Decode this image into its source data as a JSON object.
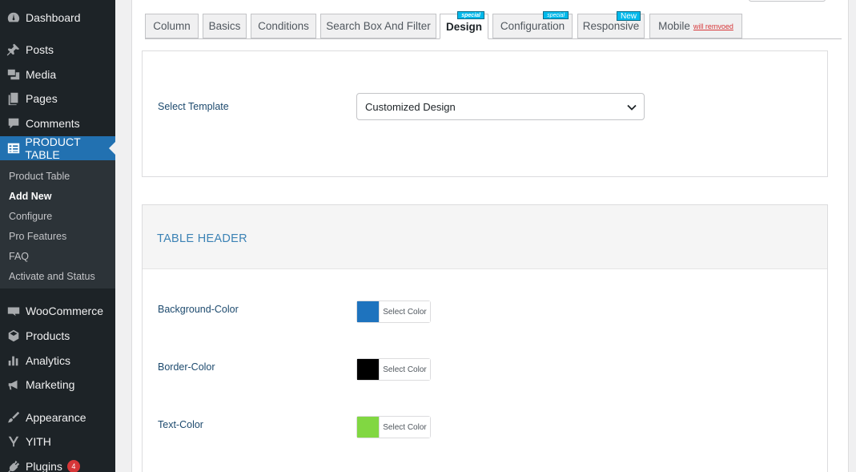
{
  "sidebar": {
    "items": [
      {
        "label": "Dashboard",
        "icon": "dashboard-icon"
      },
      {
        "label": "Posts",
        "icon": "pin-icon"
      },
      {
        "label": "Media",
        "icon": "media-icon"
      },
      {
        "label": "Pages",
        "icon": "pages-icon"
      },
      {
        "label": "Comments",
        "icon": "comment-icon"
      },
      {
        "label": "PRODUCT TABLE",
        "icon": "table-icon"
      },
      {
        "label": "WooCommerce",
        "icon": "woo-icon"
      },
      {
        "label": "Products",
        "icon": "box-icon"
      },
      {
        "label": "Analytics",
        "icon": "bar-chart-icon"
      },
      {
        "label": "Marketing",
        "icon": "megaphone-icon"
      },
      {
        "label": "Appearance",
        "icon": "brush-icon"
      },
      {
        "label": "YITH",
        "icon": "yith-icon"
      },
      {
        "label": "Plugins",
        "icon": "plug-icon",
        "badge": "4"
      }
    ],
    "submenu": [
      "Product Table",
      "Add New",
      "Configure",
      "Pro Features",
      "FAQ",
      "Activate and Status"
    ]
  },
  "tabs": [
    {
      "label": "Column"
    },
    {
      "label": "Basics"
    },
    {
      "label": "Conditions"
    },
    {
      "label": "Search Box And Filter"
    },
    {
      "label": "Design",
      "tag": "special"
    },
    {
      "label": "Configuration",
      "tag": "special"
    },
    {
      "label": "Responsive",
      "tag": "New"
    },
    {
      "label": "Mobile",
      "note": "will remvoed"
    }
  ],
  "template": {
    "label": "Select Template",
    "selected": "Customized Design"
  },
  "table_header": {
    "title": "TABLE HEADER",
    "fields": [
      {
        "label": "Background-Color",
        "color": "#1e73be",
        "button": "Select Color"
      },
      {
        "label": "Border-Color",
        "color": "#000000",
        "button": "Select Color"
      },
      {
        "label": "Text-Color",
        "color": "#81d742",
        "button": "Select Color"
      }
    ]
  },
  "colors": {
    "accent": "#2271b1",
    "sidebar_bg": "#1d2327"
  }
}
